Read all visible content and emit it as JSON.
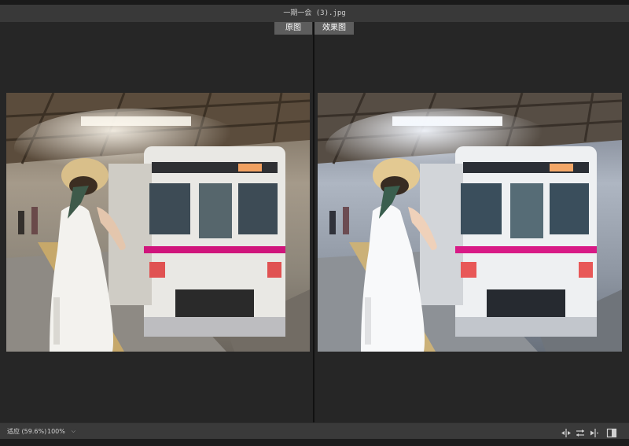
{
  "window": {
    "title": "一期一会 (3).jpg"
  },
  "compare_tabs": {
    "original": "原图",
    "effect": "效果图"
  },
  "status_bar": {
    "fit_label": "适应 (59.6%)",
    "zoom_value": "100%",
    "icons": [
      "split-vertical-icon",
      "swap-icon",
      "split-horizontal-icon",
      "side-by-side-icon"
    ]
  },
  "colors": {
    "window_bg": "#262626",
    "titlebar_bg": "#393939",
    "tab_bg": "#5d5d5d",
    "statusbar_bg": "#3a3a3a"
  }
}
